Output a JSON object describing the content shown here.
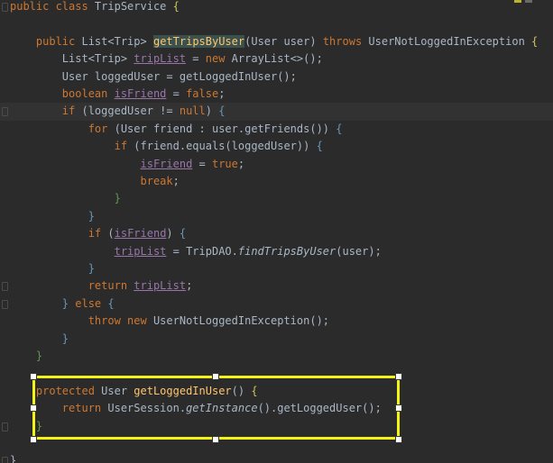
{
  "editor": {
    "lines": [
      {
        "parts": [
          [
            "kw",
            "public class "
          ],
          [
            "plain",
            "TripService "
          ],
          [
            "brace-yellow",
            "{"
          ]
        ]
      },
      {
        "parts": []
      },
      {
        "parts": [
          [
            "plain",
            "    "
          ],
          [
            "kw",
            "public "
          ],
          [
            "plain",
            "List<Trip> "
          ],
          [
            "fnhl",
            "getTripsByUser"
          ],
          [
            "plain",
            "(User user) "
          ],
          [
            "kw",
            "throws "
          ],
          [
            "plain",
            "UserNotLoggedInException "
          ],
          [
            "brace-yellow",
            "{"
          ]
        ]
      },
      {
        "parts": [
          [
            "plain",
            "        List<Trip> "
          ],
          [
            "fld-under",
            "tripList"
          ],
          [
            "plain",
            " = "
          ],
          [
            "kw",
            "new "
          ],
          [
            "plain",
            "ArrayList<>();"
          ]
        ]
      },
      {
        "parts": [
          [
            "plain",
            "        User loggedUser = getLoggedInUser();"
          ]
        ]
      },
      {
        "parts": [
          [
            "plain",
            "        "
          ],
          [
            "kw",
            "boolean "
          ],
          [
            "fld-under",
            "isFriend"
          ],
          [
            "plain",
            " = "
          ],
          [
            "kw",
            "false"
          ],
          [
            "plain",
            ";"
          ]
        ]
      },
      {
        "parts": [
          [
            "plain",
            "        "
          ],
          [
            "kw",
            "if "
          ],
          [
            "plain",
            "(loggedUser != "
          ],
          [
            "kw",
            "null"
          ],
          [
            "plain",
            ") "
          ],
          [
            "brace-blue",
            "{"
          ]
        ]
      },
      {
        "parts": [
          [
            "plain",
            "            "
          ],
          [
            "kw",
            "for "
          ],
          [
            "plain",
            "(User friend : user.getFriends()) "
          ],
          [
            "brace-blue",
            "{"
          ]
        ]
      },
      {
        "parts": [
          [
            "plain",
            "                "
          ],
          [
            "kw",
            "if "
          ],
          [
            "plain",
            "(friend.equals(loggedUser)) "
          ],
          [
            "brace-blue",
            "{"
          ]
        ]
      },
      {
        "parts": [
          [
            "plain",
            "                    "
          ],
          [
            "fld-under",
            "isFriend"
          ],
          [
            "plain",
            " = "
          ],
          [
            "kw",
            "true"
          ],
          [
            "plain",
            ";"
          ]
        ]
      },
      {
        "parts": [
          [
            "plain",
            "                    "
          ],
          [
            "kw",
            "break"
          ],
          [
            "plain",
            ";"
          ]
        ]
      },
      {
        "parts": [
          [
            "plain",
            "                "
          ],
          [
            "brace-green",
            "}"
          ]
        ]
      },
      {
        "parts": [
          [
            "plain",
            "            "
          ],
          [
            "brace-blue",
            "}"
          ]
        ]
      },
      {
        "parts": [
          [
            "plain",
            "            "
          ],
          [
            "kw",
            "if "
          ],
          [
            "plain",
            "("
          ],
          [
            "fld-under",
            "isFriend"
          ],
          [
            "plain",
            ") "
          ],
          [
            "brace-blue",
            "{"
          ]
        ]
      },
      {
        "parts": [
          [
            "plain",
            "                "
          ],
          [
            "fld-under",
            "tripList"
          ],
          [
            "plain",
            " = TripDAO."
          ],
          [
            "ital",
            "findTripsByUser"
          ],
          [
            "plain",
            "(user);"
          ]
        ]
      },
      {
        "parts": [
          [
            "plain",
            "            "
          ],
          [
            "brace-blue",
            "}"
          ]
        ]
      },
      {
        "parts": [
          [
            "plain",
            "            "
          ],
          [
            "kw",
            "return "
          ],
          [
            "fld-under",
            "tripList"
          ],
          [
            "plain",
            ";"
          ]
        ]
      },
      {
        "parts": [
          [
            "plain",
            "        "
          ],
          [
            "brace-blue",
            "} "
          ],
          [
            "kw",
            "else "
          ],
          [
            "brace-blue",
            "{"
          ]
        ]
      },
      {
        "parts": [
          [
            "plain",
            "            "
          ],
          [
            "kw",
            "throw new "
          ],
          [
            "plain",
            "UserNotLoggedInException();"
          ]
        ]
      },
      {
        "parts": [
          [
            "plain",
            "        "
          ],
          [
            "brace-blue",
            "}"
          ]
        ]
      },
      {
        "parts": [
          [
            "plain",
            "    "
          ],
          [
            "brace-green",
            "}"
          ]
        ]
      },
      {
        "parts": []
      },
      {
        "parts": [
          [
            "plain",
            "    "
          ],
          [
            "kw",
            "protected "
          ],
          [
            "plain",
            "User "
          ],
          [
            "fn",
            "getLoggedInUser"
          ],
          [
            "plain",
            "() "
          ],
          [
            "brace-yellow",
            "{"
          ]
        ]
      },
      {
        "parts": [
          [
            "plain",
            "        "
          ],
          [
            "kw",
            "return "
          ],
          [
            "plain",
            "UserSession."
          ],
          [
            "ital",
            "getInstance"
          ],
          [
            "plain",
            "().getLoggedUser();"
          ]
        ]
      },
      {
        "parts": [
          [
            "plain",
            "    "
          ],
          [
            "brace-green",
            "}"
          ]
        ]
      },
      {
        "parts": []
      },
      {
        "parts": [
          [
            "plain",
            "}"
          ]
        ]
      }
    ],
    "current_line_index": 6,
    "selection": {
      "covers_lines": [
        22,
        24
      ]
    }
  },
  "colors": {
    "background": "#2b2b2b",
    "keyword": "#cc7832",
    "method": "#ffc66d",
    "field": "#9876aa",
    "text": "#a9b7c6",
    "selection_border": "#f3f315"
  }
}
